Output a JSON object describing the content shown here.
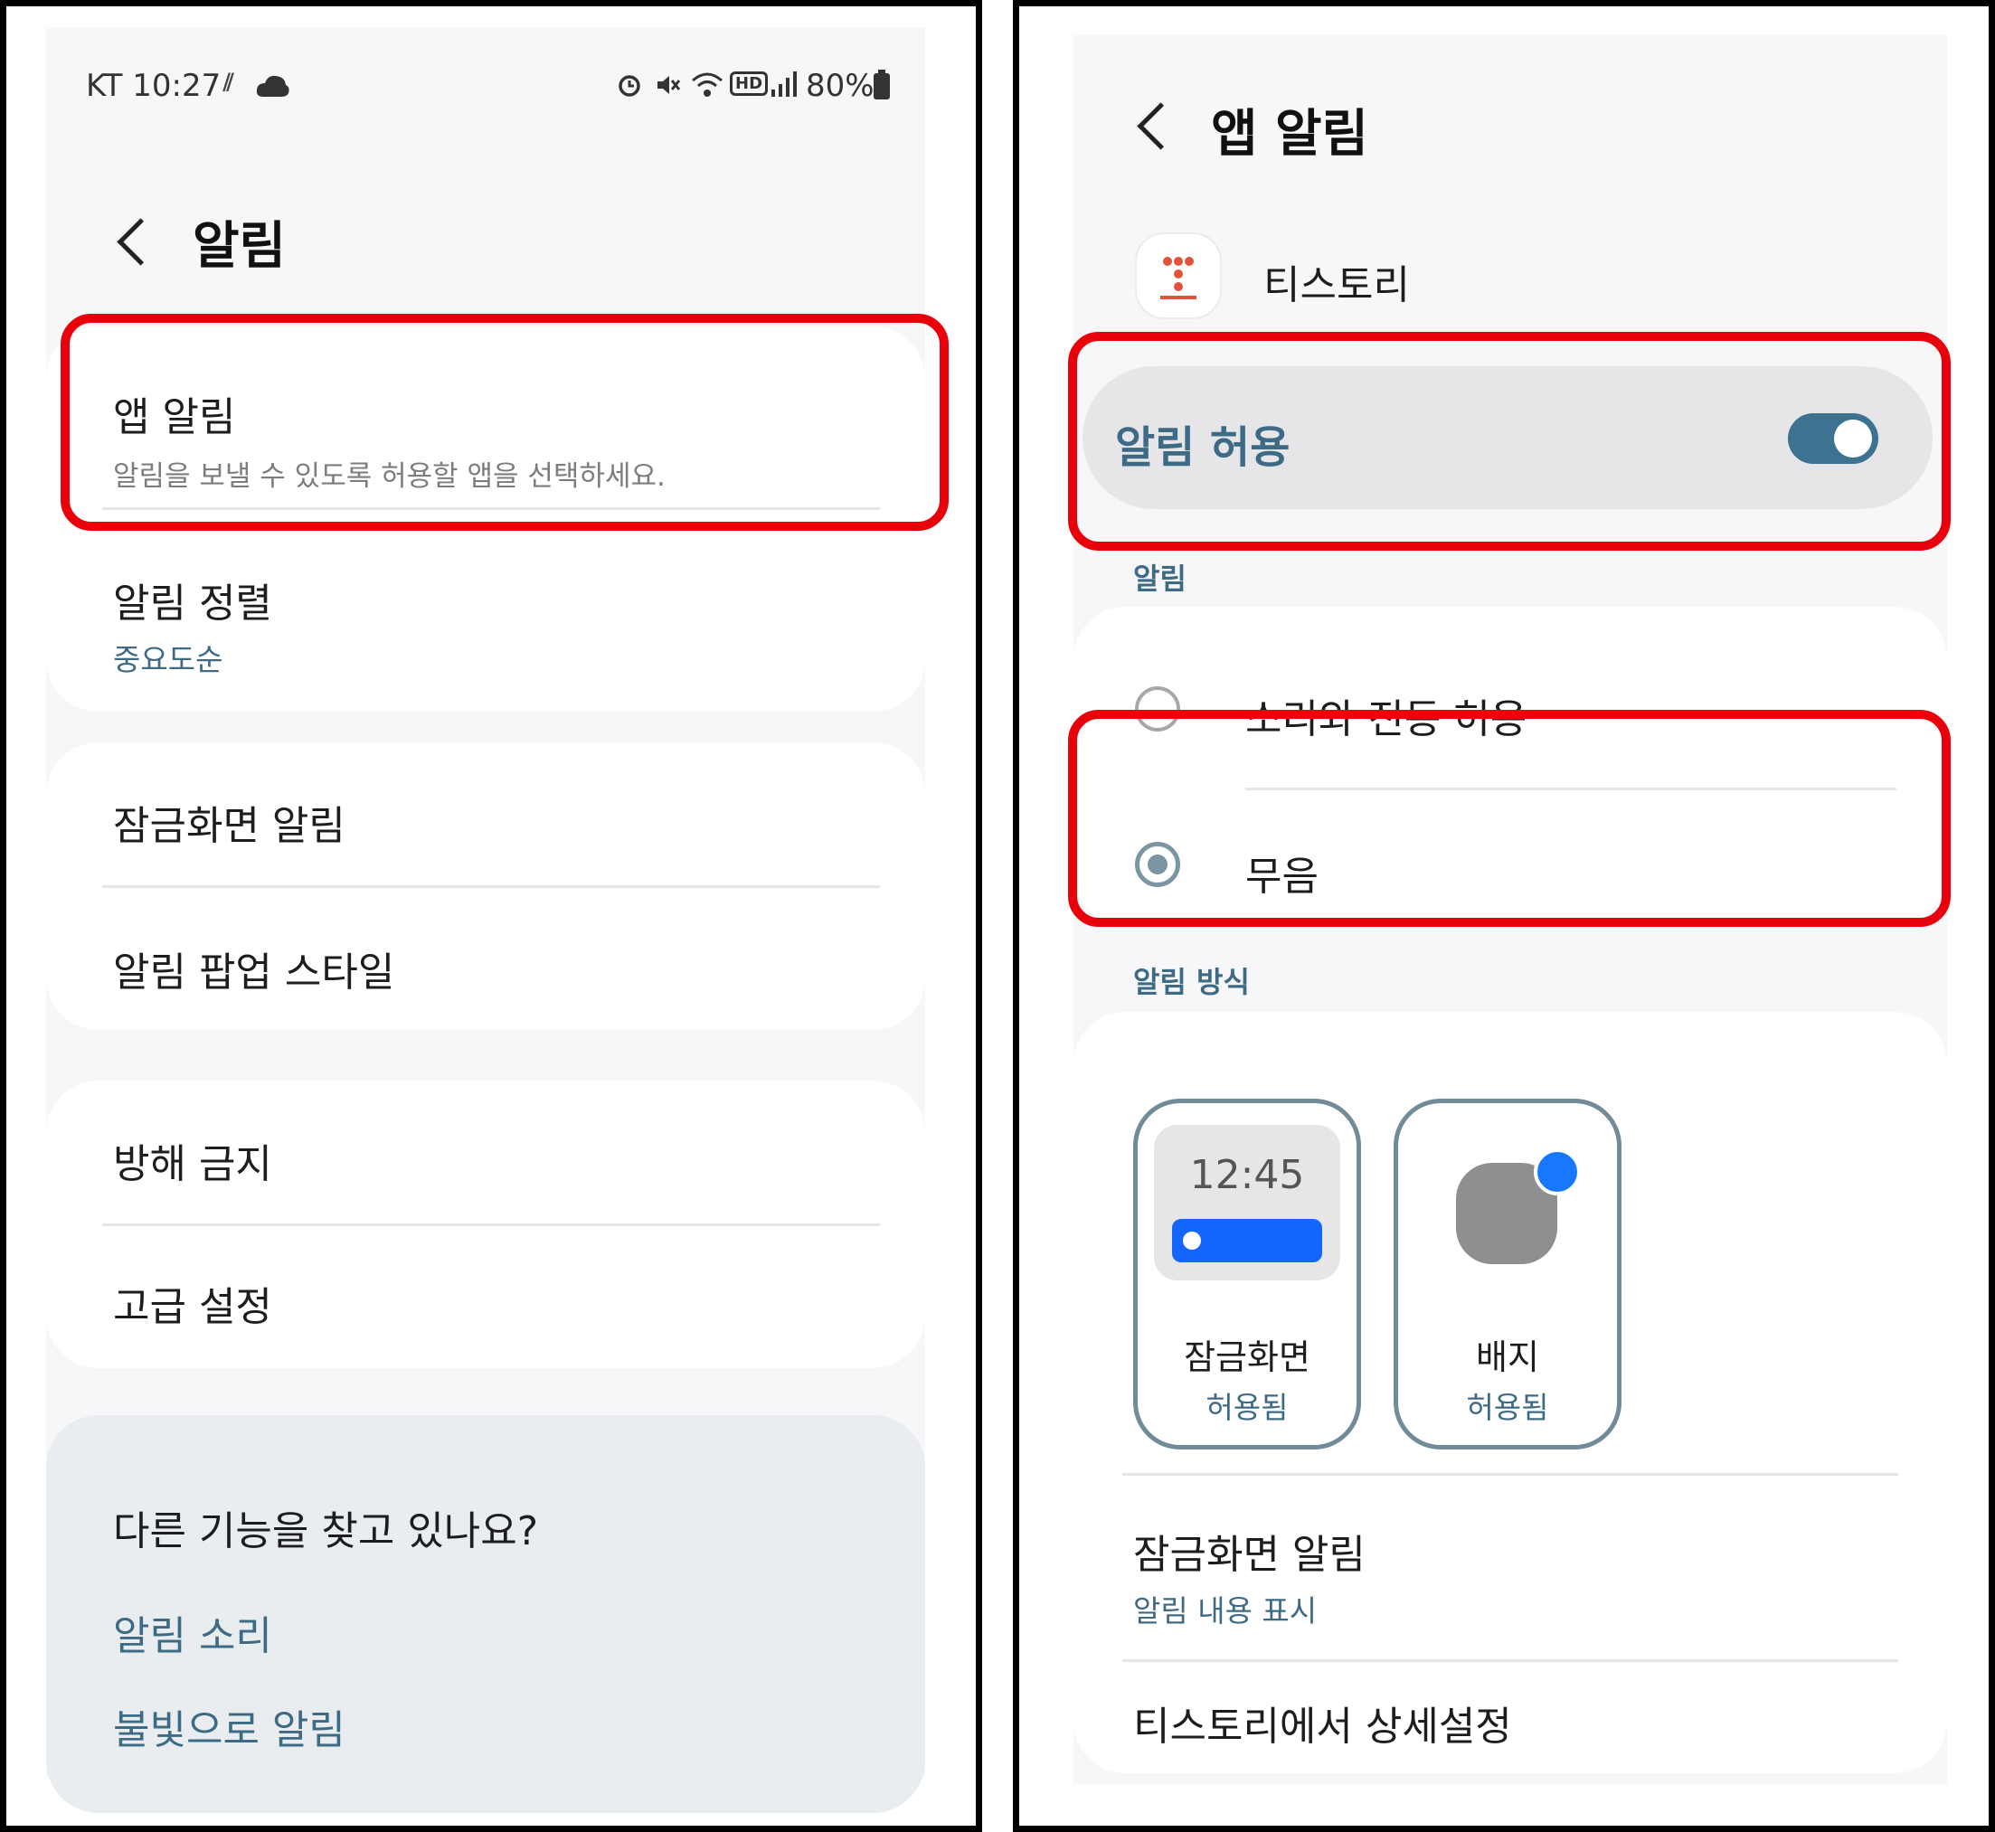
{
  "left": {
    "status_bar": {
      "carrier_time": "KT 10:27",
      "battery": "80%",
      "icons": [
        "rain-icon",
        "cloud-icon",
        "alarm-icon",
        "mute-icon",
        "wifi-icon",
        "hd-icon",
        "signal-icon",
        "battery-icon"
      ]
    },
    "header": {
      "title": "알림"
    },
    "app_notifications": {
      "title": "앱 알림",
      "subtitle": "알림을 보낼 수 있도록 허용할 앱을 선택하세요."
    },
    "sort": {
      "title": "알림 정렬",
      "value": "중요도순"
    },
    "lock_screen": {
      "title": "잠금화면 알림"
    },
    "popup_style": {
      "title": "알림 팝업 스타일"
    },
    "dnd": {
      "title": "방해 금지"
    },
    "advanced": {
      "title": "고급 설정"
    },
    "suggestions": {
      "title": "다른 기능을 찾고 있나요?",
      "links": [
        "알림 소리",
        "불빛으로 알림"
      ]
    }
  },
  "right": {
    "header": {
      "title": "앱 알림"
    },
    "app": {
      "name": "티스토리"
    },
    "allow": {
      "label": "알림 허용",
      "on": true
    },
    "section_alert": "알림",
    "options": {
      "sound_vibrate": "소리와 진동 허용",
      "silent": "무음",
      "selected": "silent"
    },
    "section_style": "알림 방식",
    "tiles": [
      {
        "preview_time": "12:45",
        "title": "잠금화면",
        "status": "허용됨"
      },
      {
        "title": "배지",
        "status": "허용됨"
      }
    ],
    "lock_screen": {
      "title": "잠금화면 알림",
      "value": "알림 내용 표시"
    },
    "more": {
      "title": "티스토리에서 상세설정"
    }
  },
  "colors": {
    "highlight": "#e8000a",
    "accent": "#3d6a84",
    "toggle": "#3d7390",
    "badge_dot": "#1877ff",
    "preview_bar": "#1565ff"
  }
}
